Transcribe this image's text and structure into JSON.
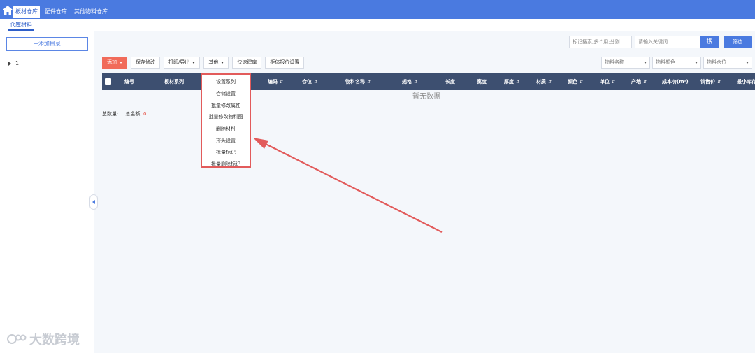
{
  "topnav": {
    "tabs": [
      {
        "label": "板材仓库",
        "active": true
      },
      {
        "label": "配件仓库",
        "active": false
      },
      {
        "label": "其他物料仓库",
        "active": false
      }
    ]
  },
  "subnav": {
    "tab": "仓库材料"
  },
  "sidebar": {
    "add_dir_label": "+添加目录",
    "tree": [
      {
        "label": "1"
      }
    ]
  },
  "search": {
    "tag_placeholder": "标记搜索,多个用;分割",
    "keyword_placeholder": "请输入关键词",
    "search_label": "搜",
    "filter_label": "筛选"
  },
  "toolbar": {
    "add_label": "添加",
    "save_label": "保存修改",
    "print_label": "打印/导出",
    "other_label": "其他",
    "quick_label": "快速建库",
    "cabinet_label": "柜体报价设置"
  },
  "filters": [
    {
      "label": "物料名称"
    },
    {
      "label": "物料颜色"
    },
    {
      "label": "物料仓位"
    }
  ],
  "table": {
    "columns": [
      {
        "label": "编号",
        "sort": false
      },
      {
        "label": "板材系列",
        "sort": false
      },
      {
        "label": "编码",
        "sort": true
      },
      {
        "label": "仓位",
        "sort": true
      },
      {
        "label": "物料名称",
        "sort": true
      },
      {
        "label": "规格",
        "sort": true
      },
      {
        "label": "长度",
        "sort": false
      },
      {
        "label": "宽度",
        "sort": false
      },
      {
        "label": "厚度",
        "sort": true
      },
      {
        "label": "材质",
        "sort": true
      },
      {
        "label": "颜色",
        "sort": true
      },
      {
        "label": "单位",
        "sort": true
      },
      {
        "label": "产地",
        "sort": true
      },
      {
        "label": "成本价(m²)",
        "sort": false
      },
      {
        "label": "销售价",
        "sort": true
      },
      {
        "label": "最小库存",
        "sort": false
      }
    ],
    "empty_text": "暂无数据",
    "sort_glyph": "⇵"
  },
  "totals": {
    "count_label": "总数量:",
    "amount_label": "总金额:",
    "amount_value": "0"
  },
  "menu": {
    "items": [
      "设置系列",
      "仓储设置",
      "批量修改属性",
      "批量修改物料图",
      "删除材料",
      "排头设置",
      "批量标记",
      "批量删除标记"
    ]
  },
  "colors": {
    "primary": "#4a7ae0",
    "header_bg": "#3d4f70",
    "add_button": "#f16b5a",
    "annotation": "#e25b5b"
  },
  "watermark": {
    "text": "大数跨境"
  }
}
